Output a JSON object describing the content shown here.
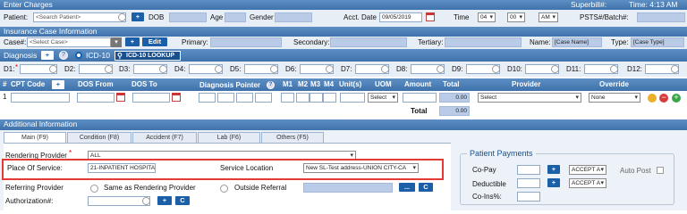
{
  "enter_charges": {
    "header": "Enter Charges",
    "superbill_label": "Superbill#:",
    "time_label": "Time: 4:13 AM",
    "patient_label": "Patient:",
    "patient_placeholder": "<Search Patient>",
    "dob_label": "DOB",
    "age_label": "Age",
    "gender_label": "Gender",
    "acct_date_label": "Acct. Date",
    "acct_date_value": "09/05/2019",
    "time_field_label": "Time",
    "hour": "04",
    "minute": "00",
    "ampm": "AM",
    "psts_label": "PSTS#/Batch#:"
  },
  "insurance": {
    "header": "Insurance Case Information",
    "case_label": "Case#:",
    "case_placeholder": "<Select Case>",
    "edit_label": "Edit",
    "primary_label": "Primary:",
    "secondary_label": "Secondary:",
    "tertiary_label": "Tertiary:",
    "name_label": "Name:",
    "name_value": "[Case Name]",
    "type_label": "Type:",
    "type_value": "[Case Type]"
  },
  "diagnosis": {
    "header": "Diagnosis",
    "icd10_label": "ICD-10",
    "lookup_label": "ICD-10 LOOKUP",
    "codes": [
      "D1:",
      "D2:",
      "D3:",
      "D4:",
      "D5:",
      "D6:",
      "D7:",
      "D8:",
      "D9:",
      "D10:",
      "D11:",
      "D12:"
    ]
  },
  "cpt": {
    "hash": "#",
    "cpt_code": "CPT Code",
    "dos_from": "DOS From",
    "dos_to": "DOS To",
    "diag_pointer": "Diagnosis Pointer",
    "m1": "M1",
    "m2": "M2",
    "m3": "M3",
    "m4": "M4",
    "units": "Unit(s)",
    "uom": "UOM",
    "amount": "Amount",
    "total": "Total",
    "provider": "Provider",
    "override": "Override",
    "row_num": "1",
    "uom_select": "Select",
    "row_total": "0.00",
    "provider_select": "Select",
    "override_select": "None",
    "total_label": "Total",
    "total_value": "0.00"
  },
  "additional": {
    "header": "Additional Information",
    "tabs": [
      "Main (F9)",
      "Condition (F8)",
      "Accident (F7)",
      "Lab (F6)",
      "Others (F5)"
    ],
    "rendering_provider_label": "Rendering Provider",
    "rendering_provider_value": "ALL",
    "place_of_service_label": "Place Of Service:",
    "place_of_service_value": "21-INPATIENT HOSPITA",
    "service_location_label": "Service Location",
    "service_location_value": "New SL-Test address-UNION CITY-CA",
    "referring_provider_label": "Referring Provider",
    "same_as_rendering_label": "Same as Rendering Provider",
    "outside_referral_label": "Outside Referral",
    "ellipsis_label": "...",
    "c_label": "C",
    "authorization_label": "Authorization#:",
    "c2_label": "C"
  },
  "payments": {
    "header": "Patient Payments",
    "copay_label": "Co-Pay",
    "accept1": "ACCEPT A",
    "auto_post_label": "Auto Post",
    "deductible_label": "Deductible",
    "accept2": "ACCEPT A",
    "coins_label": "Co-Ins%:"
  },
  "colors": {
    "header_blue": "#3f72ab",
    "highlight_red": "#e53935",
    "button_blue": "#1a5fa8"
  }
}
